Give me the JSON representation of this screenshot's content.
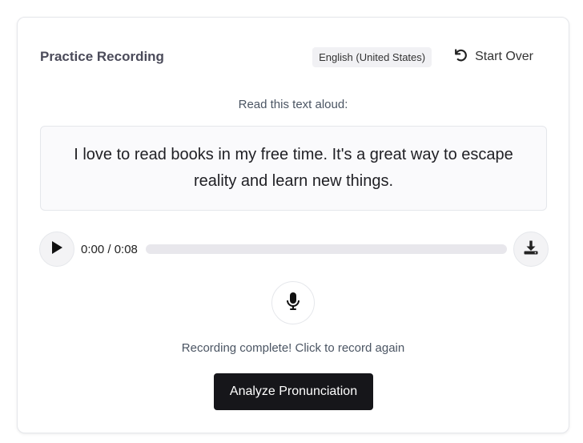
{
  "header": {
    "title": "Practice Recording",
    "language": "English (United States)",
    "start_over_label": "Start Over"
  },
  "instruction": "Read this text aloud:",
  "passage": "I love to read books in my free time. It's a great way to escape reality and learn new things.",
  "player": {
    "time": "0:00 / 0:08",
    "progress": 0
  },
  "status": "Recording complete! Click to record again",
  "analyze_label": "Analyze Pronunciation",
  "icons": {
    "start_over": "undo-icon",
    "play": "play-icon",
    "download": "download-icon",
    "mic": "microphone-icon"
  },
  "colors": {
    "button_bg": "#16161a",
    "track": "#e8e7ec"
  }
}
